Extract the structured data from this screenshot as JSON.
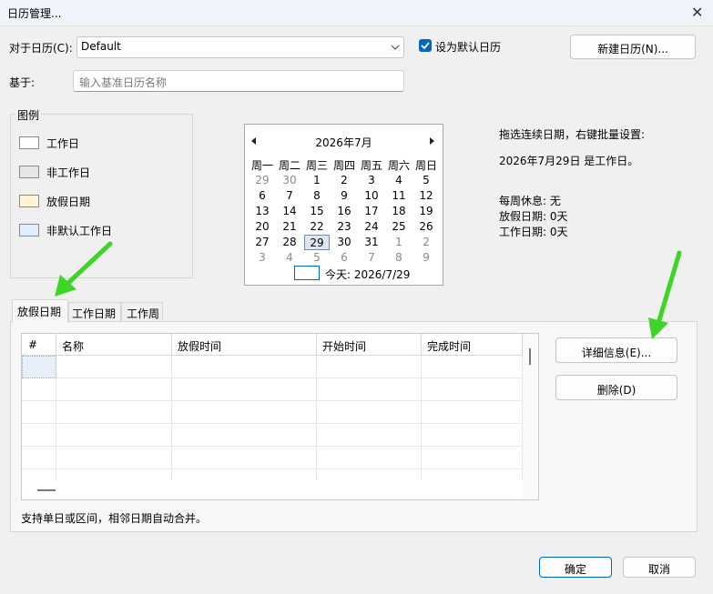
{
  "window": {
    "title": "日历管理..."
  },
  "calendar_for": {
    "label": "对于日历(C):",
    "value": "Default"
  },
  "default_checkbox": {
    "label": "设为默认日历",
    "checked": true
  },
  "new_calendar_button": "新建日历(N)...",
  "based_on": {
    "label": "基于:",
    "placeholder": "输入基准日历名称"
  },
  "legend": {
    "title": "图例",
    "items": [
      {
        "label": "工作日",
        "color": "#ffffff"
      },
      {
        "label": "非工作日",
        "color": "#e6e6e6"
      },
      {
        "label": "放假日期",
        "color": "#fff5d6"
      },
      {
        "label": "非默认工作日",
        "color": "#ddeeff"
      }
    ]
  },
  "month_calendar": {
    "month_title": "2026年7月",
    "weekdays": [
      "周一",
      "周二",
      "周三",
      "周四",
      "周五",
      "周六",
      "周日"
    ],
    "weeks": [
      [
        "29",
        "30",
        "1",
        "2",
        "3",
        "4",
        "5"
      ],
      [
        "6",
        "7",
        "8",
        "9",
        "10",
        "11",
        "12"
      ],
      [
        "13",
        "14",
        "15",
        "16",
        "17",
        "18",
        "19"
      ],
      [
        "20",
        "21",
        "22",
        "23",
        "24",
        "25",
        "26"
      ],
      [
        "27",
        "28",
        "29",
        "30",
        "31",
        "1",
        "2"
      ],
      [
        "3",
        "4",
        "5",
        "6",
        "7",
        "8",
        "9"
      ]
    ],
    "selected_day": "29",
    "today_label": "今天: 2026/7/29"
  },
  "info": {
    "hint": "拖选连续日期，右键批量设置:",
    "status": "2026年7月29日 是工作日。",
    "weekly_rest": "每周休息: 无",
    "holiday_days": "放假日期: 0天",
    "work_days": "工作日期: 0天"
  },
  "tabs": [
    "放假日期",
    "工作日期",
    "工作周"
  ],
  "active_tab": "放假日期",
  "table": {
    "columns": [
      "#",
      "名称",
      "放假时间",
      "开始时间",
      "完成时间"
    ],
    "rows": []
  },
  "details_button": "详细信息(E)...",
  "delete_button": "删除(D)",
  "footer_note": "支持单日或区间，相邻日期自动合并。",
  "ok_button": "确定",
  "cancel_button": "取消",
  "accent_color": "#0067c0",
  "annotation_color": "#3dd627"
}
